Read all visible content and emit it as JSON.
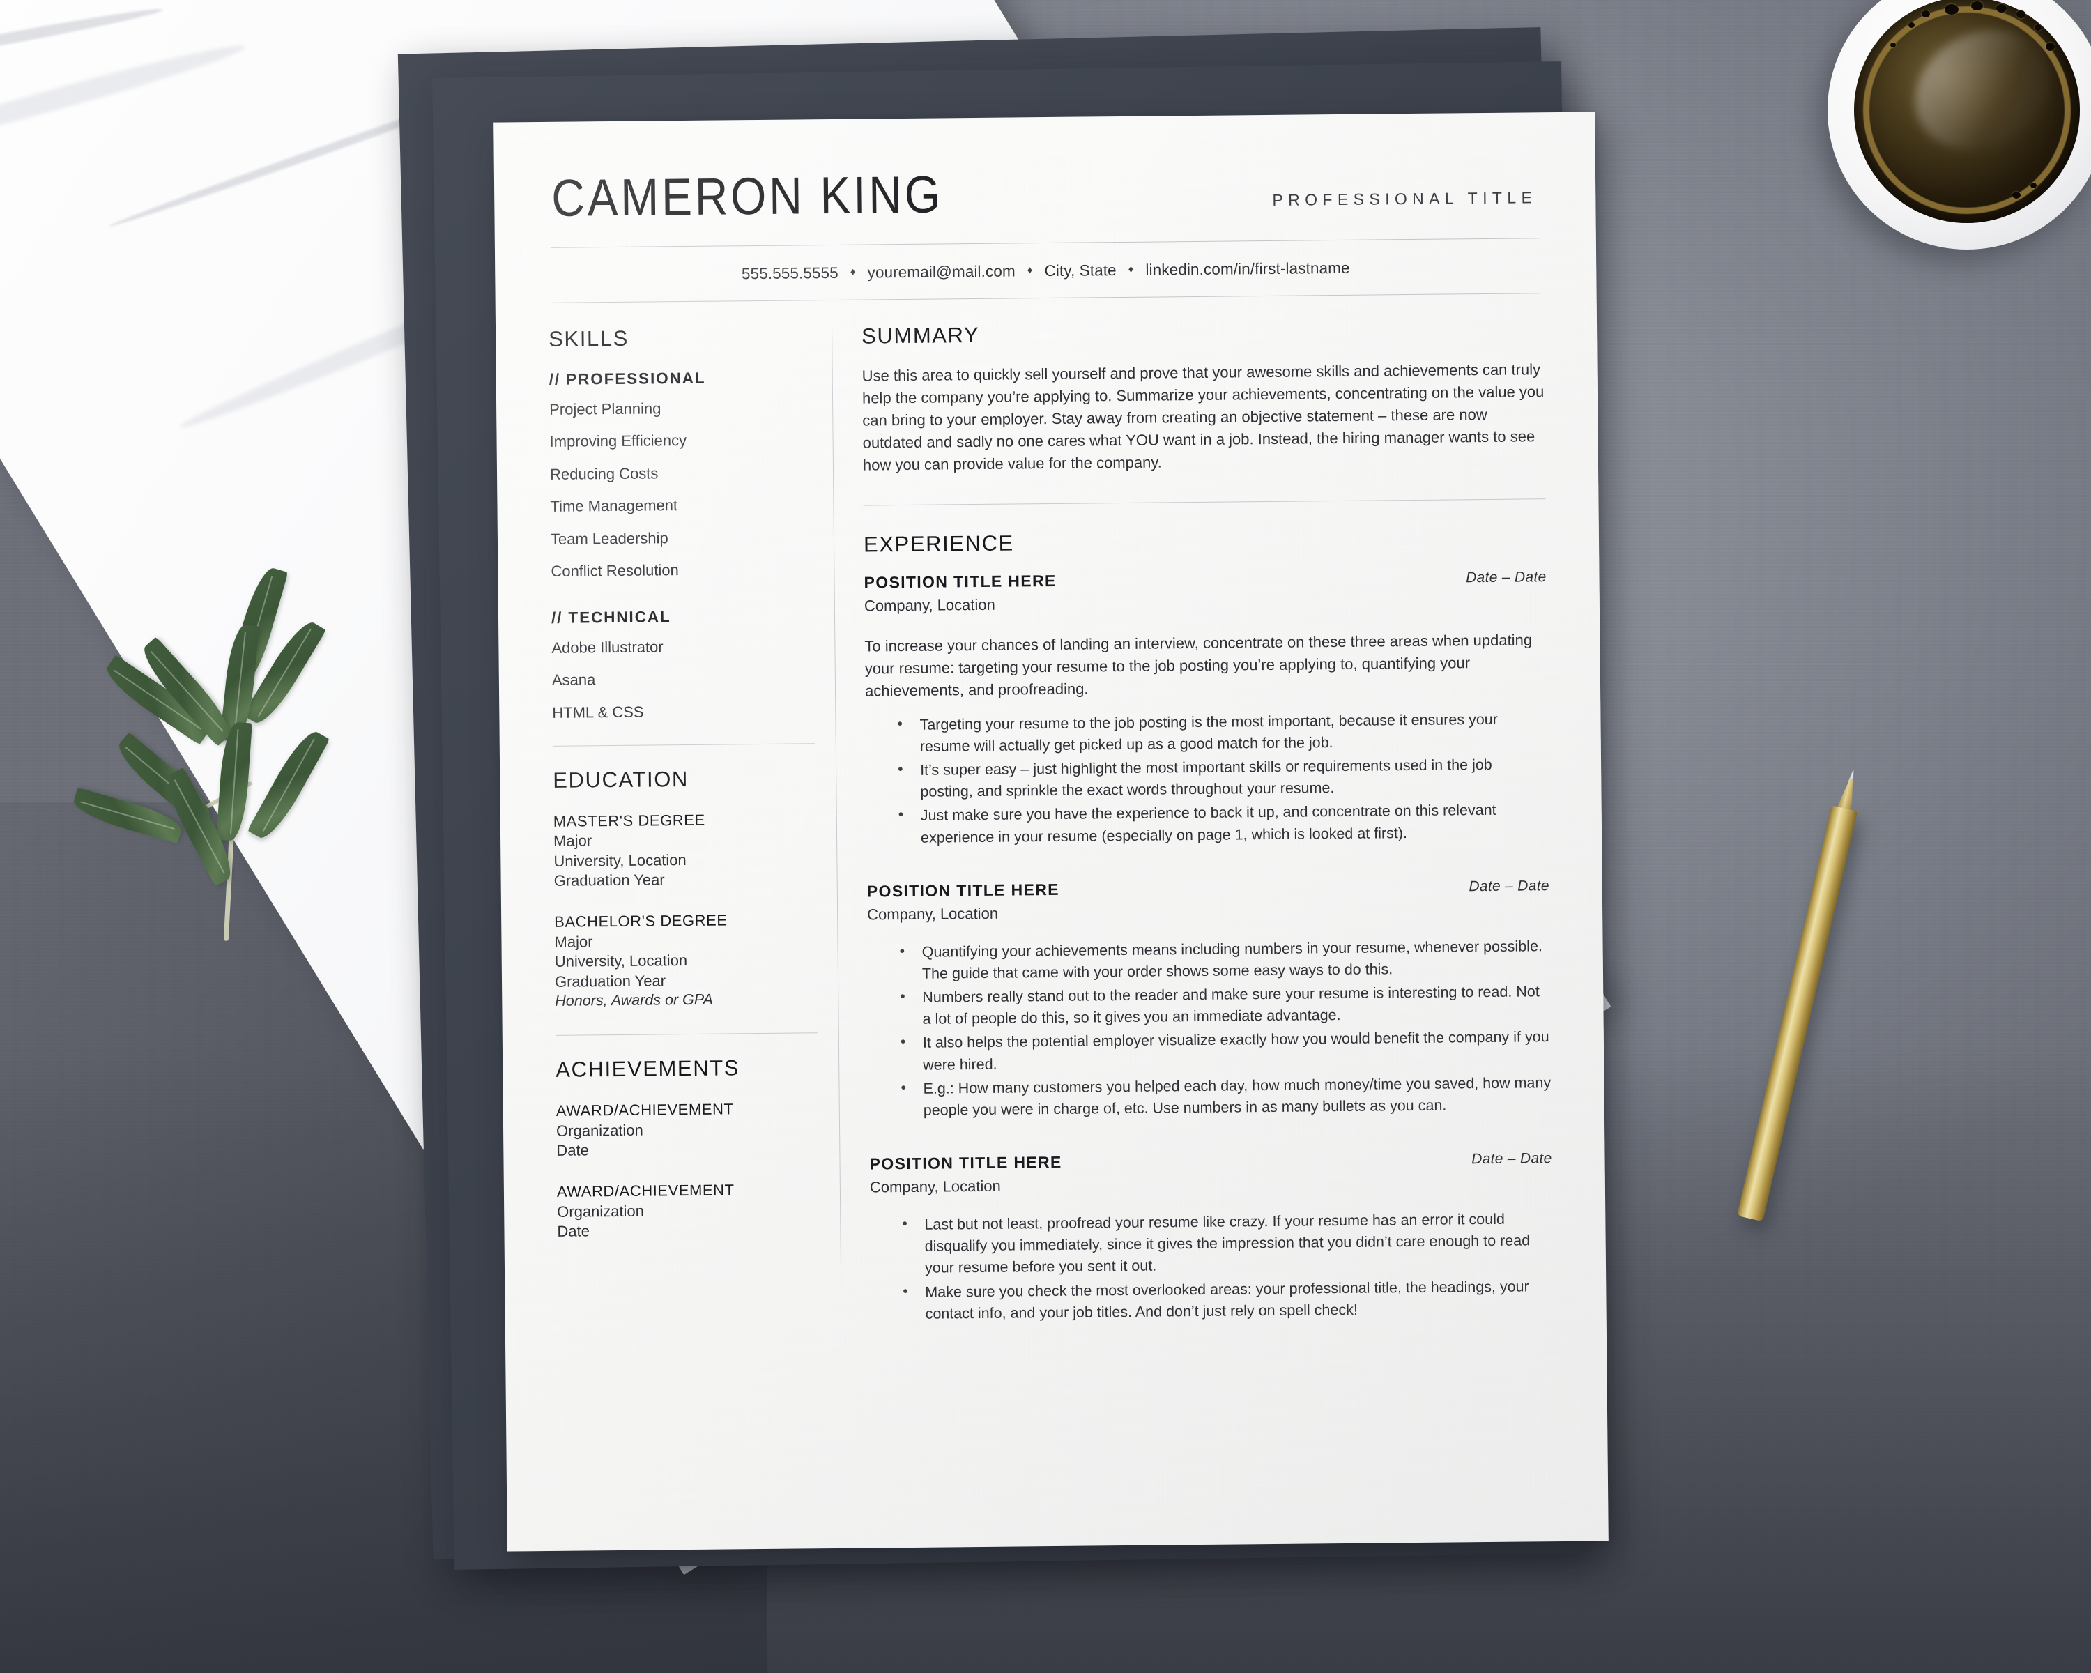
{
  "scene": {
    "surface": "grey desk",
    "objects": [
      "marble-slab",
      "olive-branch",
      "dark-folders",
      "coffee-cup",
      "gold-pen",
      "resume-page"
    ],
    "colors": {
      "desk": "#878b94",
      "marble": "#fbfbfc",
      "folder": "#3c414b",
      "paper": "#f8f8f7",
      "leaf": "#44603f",
      "pen_gold": "#d8c277",
      "coffee": "#241b0c",
      "crema": "#967a3a"
    }
  },
  "resume": {
    "header": {
      "name": "CAMERON KING",
      "professional_title": "PROFESSIONAL TITLE"
    },
    "contact": {
      "separator": "♦",
      "items": [
        "555.555.5555",
        "youremail@mail.com",
        "City, State",
        "linkedin.com/in/first-lastname"
      ]
    },
    "sidebar": {
      "skills": {
        "heading": "SKILLS",
        "groups": [
          {
            "label": "// PROFESSIONAL",
            "items": [
              "Project Planning",
              "Improving Efficiency",
              "Reducing Costs",
              "Time Management",
              "Team Leadership",
              "Conflict Resolution"
            ]
          },
          {
            "label": "// TECHNICAL",
            "items": [
              "Adobe Illustrator",
              "Asana",
              "HTML & CSS"
            ]
          }
        ]
      },
      "education": {
        "heading": "EDUCATION",
        "entries": [
          {
            "degree": "MASTER'S DEGREE",
            "major": "Major",
            "university": "University, Location",
            "year": "Graduation Year",
            "honors": ""
          },
          {
            "degree": "BACHELOR'S DEGREE",
            "major": "Major",
            "university": "University, Location",
            "year": "Graduation Year",
            "honors": "Honors, Awards or GPA"
          }
        ]
      },
      "achievements": {
        "heading": "ACHIEVEMENTS",
        "entries": [
          {
            "title": "AWARD/ACHIEVEMENT",
            "organization": "Organization",
            "date": "Date"
          },
          {
            "title": "AWARD/ACHIEVEMENT",
            "organization": "Organization",
            "date": "Date"
          }
        ]
      }
    },
    "main": {
      "summary": {
        "heading": "SUMMARY",
        "text": "Use this area to quickly sell yourself and prove that your awesome skills and achievements can truly help the company you’re applying to. Summarize your achievements, concentrating on the value you can bring to your employer. Stay away from creating an objective statement – these are now outdated and sadly no one cares what YOU want in a job. Instead, the hiring manager wants to see how you can provide value for the company."
      },
      "experience": {
        "heading": "EXPERIENCE",
        "jobs": [
          {
            "title": "POSITION TITLE HERE",
            "dates": "Date – Date",
            "company": "Company, Location",
            "intro": "To increase your chances of landing an interview, concentrate on these three areas when updating your resume: targeting your resume to the job posting you’re applying to, quantifying your achievements, and proofreading.",
            "bullets": [
              "Targeting your resume to the job posting is the most important, because it ensures your resume will actually get picked up as a good match for the job.",
              "It’s super easy – just highlight the most important skills or requirements used in the job posting, and sprinkle the exact words throughout your resume.",
              "Just make sure you have the experience to back it up, and concentrate on this relevant experience in your resume (especially on page 1, which is looked at first)."
            ]
          },
          {
            "title": "POSITION TITLE HERE",
            "dates": "Date – Date",
            "company": "Company, Location",
            "intro": "",
            "bullets": [
              "Quantifying your achievements means including numbers in your resume, whenever possible. The guide that came with your order shows some easy ways to do this.",
              "Numbers really stand out to the reader and make sure your resume is interesting to read. Not a lot of people do this, so it gives you an immediate advantage.",
              "It also helps the potential employer visualize exactly how you would benefit the company if you were hired.",
              "E.g.: How many customers you helped each day, how much money/time you saved, how many people you were in charge of, etc. Use numbers in as many bullets as you can."
            ]
          },
          {
            "title": "POSITION TITLE HERE",
            "dates": "Date – Date",
            "company": "Company, Location",
            "intro": "",
            "bullets": [
              "Last but not least, proofread your resume like crazy. If your resume has an error it could disqualify you immediately, since it gives the impression that you didn’t care enough to read your resume before you sent it out.",
              "Make sure you check the most overlooked areas: your professional title, the headings, your contact info, and your job titles. And don’t just rely on spell check!"
            ]
          }
        ]
      }
    }
  }
}
